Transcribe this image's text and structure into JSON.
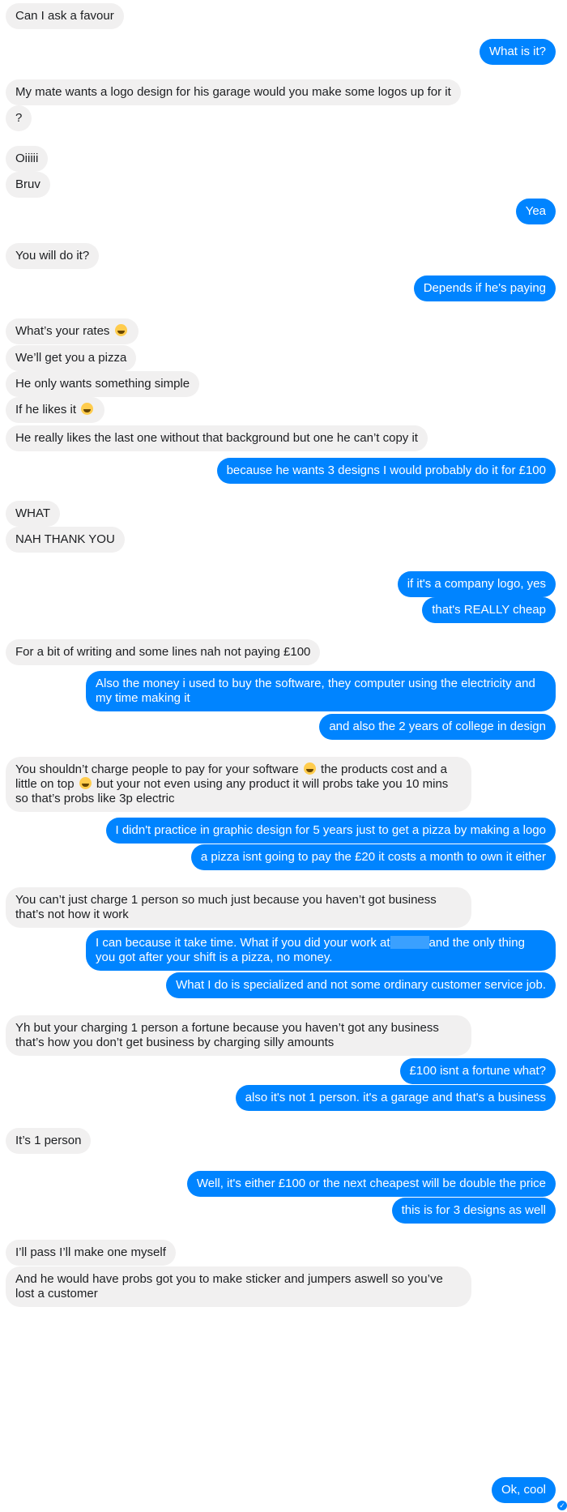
{
  "messages": [
    {
      "side": "in",
      "text": "Can I ask a favour"
    },
    {
      "side": "out",
      "text": "What is it?"
    },
    {
      "side": "in",
      "text": "My mate wants a logo design for his garage would you make some logos up for it"
    },
    {
      "side": "in",
      "text": "?"
    },
    {
      "side": "in",
      "text": "Oiiiii"
    },
    {
      "side": "in",
      "text": "Bruv"
    },
    {
      "side": "out",
      "text": "Yea"
    },
    {
      "side": "in",
      "text": "You will do it?"
    },
    {
      "side": "out",
      "text": "Depends if he's paying"
    },
    {
      "side": "in",
      "text": "What’s your rates",
      "emoji": "laughing-emoji"
    },
    {
      "side": "in",
      "text": "We’ll get you a pizza"
    },
    {
      "side": "in",
      "text": "He only wants something simple"
    },
    {
      "side": "in",
      "text": "If he likes it",
      "emoji": "wink-emoji"
    },
    {
      "side": "in",
      "text": "He really likes the last one without that background but one he can’t copy it"
    },
    {
      "side": "out",
      "text": "because he wants 3 designs I would probably do it for £100"
    },
    {
      "side": "in",
      "text": "WHAT"
    },
    {
      "side": "in",
      "text": "NAH THANK YOU"
    },
    {
      "side": "out",
      "text": "if it's a company logo, yes"
    },
    {
      "side": "out",
      "text": "that's REALLY cheap"
    },
    {
      "side": "in",
      "text": "For a bit of writing and some lines nah not paying £100"
    },
    {
      "side": "out",
      "text": "Also the money i used to buy the software, they computer using the electricity and my time making it"
    },
    {
      "side": "out",
      "text": "and also the 2 years of college in design"
    },
    {
      "side": "in",
      "text": "You shouldn’t charge people to pay for your software",
      "emoji_mid": "laughing-emoji",
      "text2": "the products cost and a little on top",
      "emoji_mid2": "laughing-emoji",
      "text3": "but your not even using any product it will probs take you 10 mins so that’s probs like 3p electric"
    },
    {
      "side": "out",
      "text": "I didn't practice in graphic design for 5 years just to get a pizza by making a logo"
    },
    {
      "side": "out",
      "text": "a pizza isnt going to pay the £20 it costs a month to own it either"
    },
    {
      "side": "in",
      "text": "You can’t just charge 1 person so much just because you haven’t got business that’s not how it work"
    },
    {
      "side": "out",
      "text": "I can because it take time. What if you did your work at",
      "redact": true,
      "text2": "and the only thing you got after your shift is a pizza, no money."
    },
    {
      "side": "out",
      "text": "What I do is specialized and not some ordinary customer service job."
    },
    {
      "side": "in",
      "text": "Yh but your charging 1 person a fortune because you haven’t got any business that’s how you don’t get business by charging silly amounts"
    },
    {
      "side": "out",
      "text": "£100 isnt a fortune what?"
    },
    {
      "side": "out",
      "text": "also it's not 1 person. it's a garage and that's a business"
    },
    {
      "side": "in",
      "text": "It’s 1 person"
    },
    {
      "side": "out",
      "text": "Well, it's either £100 or the next cheapest will be double the price"
    },
    {
      "side": "out",
      "text": "this is for 3 designs as well"
    },
    {
      "side": "in",
      "text": "I’ll pass I’ll make one myself"
    },
    {
      "side": "in",
      "text": "And he would have probs got you to make sticker and jumpers aswell so you’ve lost a customer"
    },
    {
      "side": "out",
      "text": "Ok, cool"
    }
  ],
  "colors": {
    "incoming": "#f1f0f0",
    "outgoing": "#0084ff",
    "seen_check": "#0084ff"
  },
  "seen_indicator": "check-icon"
}
